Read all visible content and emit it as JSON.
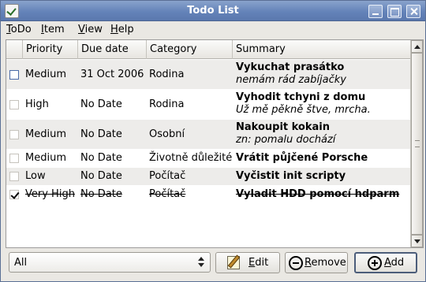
{
  "window": {
    "title": "Todo List"
  },
  "menu": [
    "ToDo",
    "Item",
    "View",
    "Help"
  ],
  "columns": {
    "done": "",
    "priority": "Priority",
    "due": "Due date",
    "category": "Category",
    "summary": "Summary"
  },
  "rows": [
    {
      "done": false,
      "priority": "Medium",
      "due": "31 Oct 2006",
      "category": "Rodina",
      "summary": "Vykuchat prasátko",
      "comment": "nemám rád zabíjačky"
    },
    {
      "done": false,
      "priority": "High",
      "due": "No Date",
      "category": "Rodina",
      "summary": "Vyhodit tchyni z domu",
      "comment": "Už mě pěkně štve, mrcha."
    },
    {
      "done": false,
      "priority": "Medium",
      "due": "No Date",
      "category": "Osobní",
      "summary": "Nakoupit kokain",
      "comment": "zn: pomalu dochází"
    },
    {
      "done": false,
      "priority": "Medium",
      "due": "No Date",
      "category": "Životně důležité",
      "summary": "Vrátit půjčené Porsche",
      "comment": ""
    },
    {
      "done": false,
      "priority": "Low",
      "due": "No Date",
      "category": "Počítač",
      "summary": "Vyčistit init scripty",
      "comment": ""
    },
    {
      "done": true,
      "priority": "Very High",
      "due": "No Date",
      "category": "Počítač",
      "summary": "Vyladit HDD pomocí hdparm",
      "comment": ""
    }
  ],
  "filter": {
    "selected": "All"
  },
  "buttons": {
    "edit": "Edit",
    "remove": "Remove",
    "add": "Add"
  },
  "icons": {
    "app": "todo-check-icon",
    "edit": "edit-pencil-icon",
    "remove": "remove-icon",
    "add": "add-icon"
  },
  "colors": {
    "titlebar": "#6483b9",
    "row_alt": "#edecea",
    "window_bg": "#eae8e3"
  }
}
